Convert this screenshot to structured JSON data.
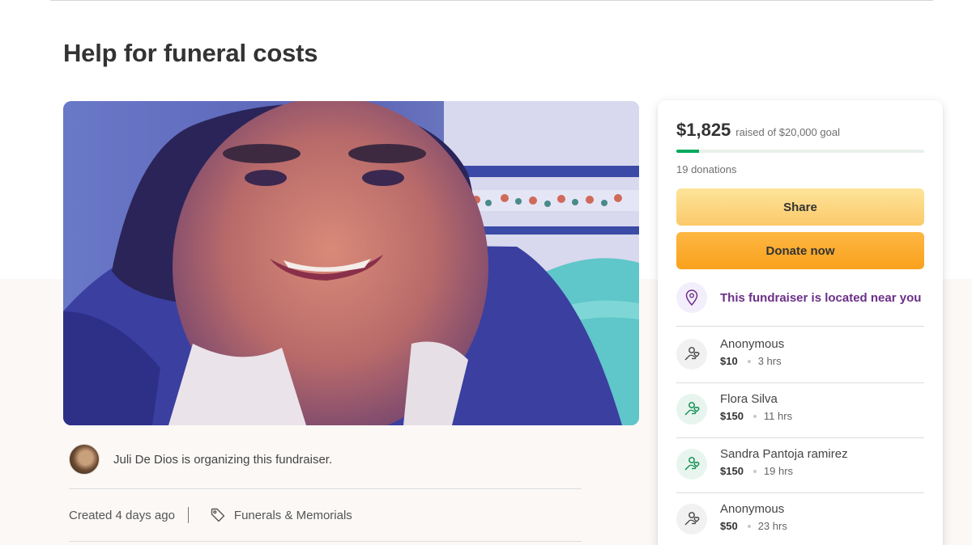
{
  "page": {
    "title": "Help for funeral costs"
  },
  "organizer": {
    "text": "Juli De Dios is organizing this fundraiser."
  },
  "meta": {
    "created": "Created 4 days ago",
    "category": "Funerals & Memorials"
  },
  "stats": {
    "raised": "$1,825",
    "goal_text": "raised of $20,000 goal",
    "progress_fraction": 0.09,
    "donations": "19 donations"
  },
  "buttons": {
    "share": "Share",
    "donate": "Donate now"
  },
  "location": {
    "text": "This fundraiser is located near you"
  },
  "donors": [
    {
      "name": "Anonymous",
      "amount": "$10",
      "time": "3 hrs"
    },
    {
      "name": "Flora Silva",
      "amount": "$150",
      "time": "11 hrs"
    },
    {
      "name": "Sandra Pantoja ramirez",
      "amount": "$150",
      "time": "19 hrs"
    },
    {
      "name": "Anonymous",
      "amount": "$50",
      "time": "23 hrs"
    }
  ],
  "colors": {
    "progress": "#02a95c",
    "share": "#fbc96a",
    "donate": "#f9a11c",
    "location_text": "#6b2f88"
  }
}
